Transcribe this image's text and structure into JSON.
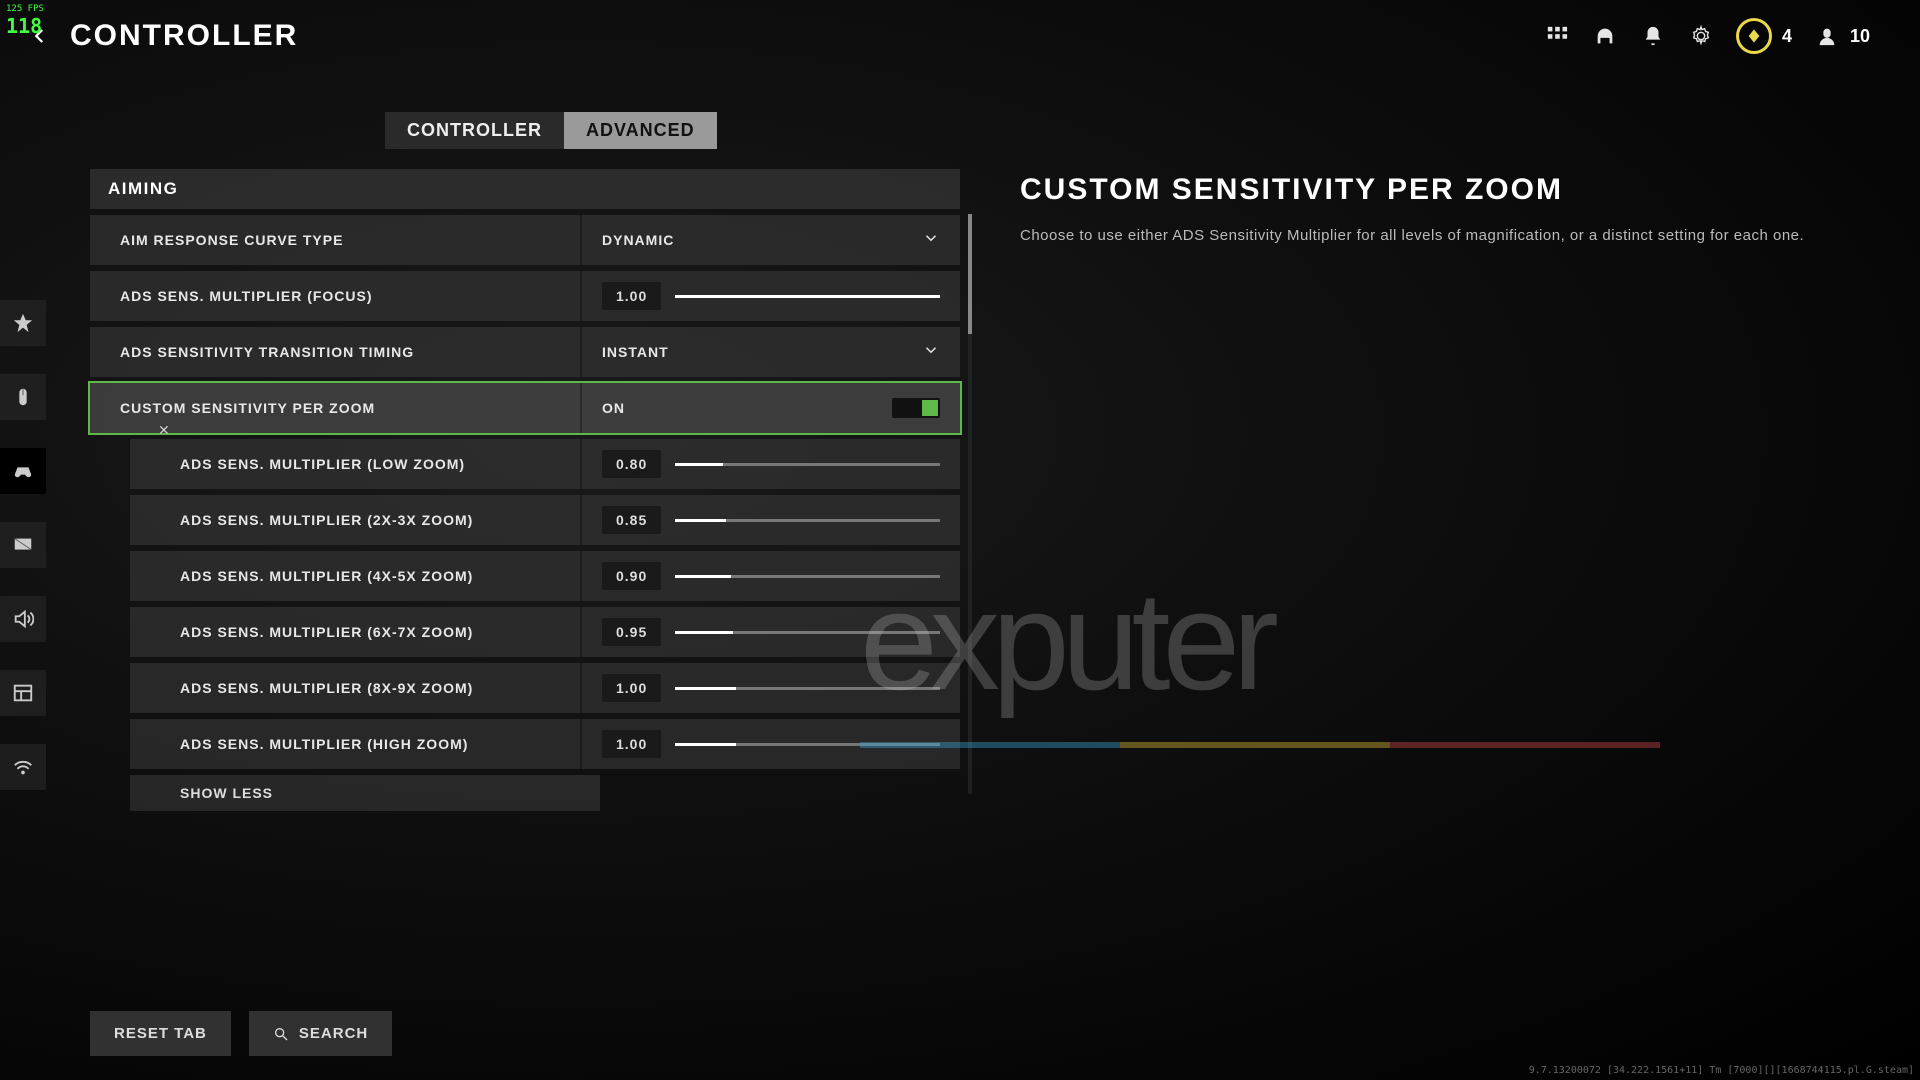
{
  "fps": "118",
  "fps_small": "125 FPS",
  "header": {
    "title": "CONTROLLER",
    "currency": "4",
    "party": "10"
  },
  "tabs": {
    "controller": "CONTROLLER",
    "advanced": "ADVANCED"
  },
  "section": "AIMING",
  "rows": {
    "curve_label": "AIM RESPONSE CURVE TYPE",
    "curve_value": "DYNAMIC",
    "focus_label": "ADS SENS. MULTIPLIER (FOCUS)",
    "focus_value": "1.00",
    "timing_label": "ADS SENSITIVITY TRANSITION TIMING",
    "timing_value": "INSTANT",
    "custom_label": "CUSTOM SENSITIVITY PER ZOOM",
    "custom_value": "ON",
    "low_label": "ADS SENS. MULTIPLIER (LOW ZOOM)",
    "low_value": "0.80",
    "z23_label": "ADS SENS. MULTIPLIER (2X-3X ZOOM)",
    "z23_value": "0.85",
    "z45_label": "ADS SENS. MULTIPLIER (4X-5X ZOOM)",
    "z45_value": "0.90",
    "z67_label": "ADS SENS. MULTIPLIER (6X-7X ZOOM)",
    "z67_value": "0.95",
    "z89_label": "ADS SENS. MULTIPLIER (8X-9X ZOOM)",
    "z89_value": "1.00",
    "high_label": "ADS SENS. MULTIPLIER (HIGH ZOOM)",
    "high_value": "1.00"
  },
  "show_less": "SHOW LESS",
  "detail": {
    "title": "CUSTOM SENSITIVITY PER ZOOM",
    "desc": "Choose to use either ADS Sensitivity Multiplier for all levels of magnification, or a distinct setting for each one."
  },
  "footer": {
    "reset": "RESET TAB",
    "search": "SEARCH"
  },
  "version": "9.7.13200072 [34.222.1561+11] Tm [7000][][1668744115.pl.G.steam]",
  "watermark": "exputer"
}
